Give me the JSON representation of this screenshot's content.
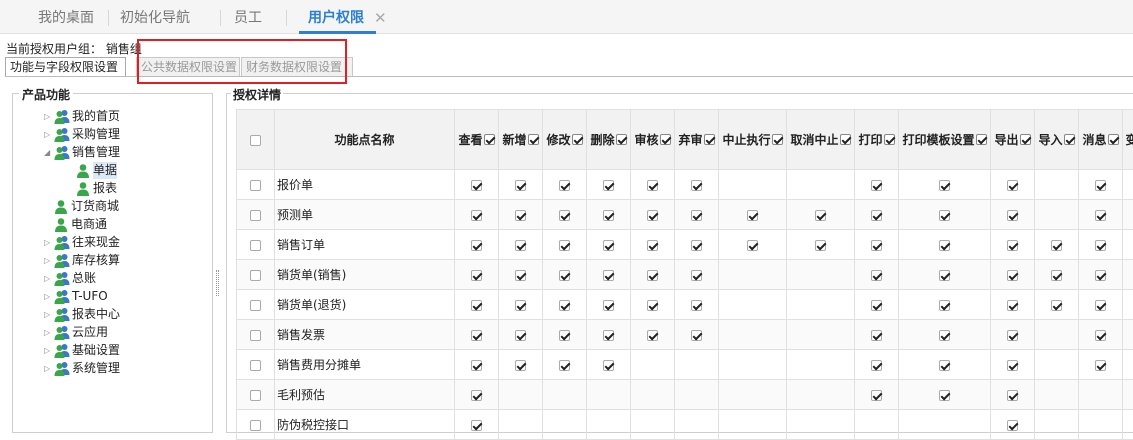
{
  "top_tabs": [
    {
      "label": "我的桌面",
      "active": false
    },
    {
      "label": "初始化导航",
      "active": false
    },
    {
      "label": "员工",
      "active": false
    },
    {
      "label": "用户权限",
      "active": true,
      "closable": true
    }
  ],
  "close_glyph": "✕",
  "role_line": "当前授权用户组： 销售组",
  "sub_tabs": [
    {
      "label": "功能与字段权限设置",
      "active": true
    },
    {
      "label": "公共数据权限设置",
      "active": false
    },
    {
      "label": "财务数据权限设置",
      "active": false
    }
  ],
  "left_panel": {
    "title": "产品功能",
    "tree": [
      {
        "label": "我的首页",
        "level": 1,
        "arrow": "▷",
        "icon": "user-group-icon"
      },
      {
        "label": "采购管理",
        "level": 1,
        "arrow": "▷",
        "icon": "user-group-icon"
      },
      {
        "label": "销售管理",
        "level": 1,
        "arrow": "◢",
        "icon": "user-group-icon"
      },
      {
        "label": "单据",
        "level": 2,
        "arrow": "",
        "icon": "user-icon",
        "selected": true
      },
      {
        "label": "报表",
        "level": 2,
        "arrow": "",
        "icon": "user-icon"
      },
      {
        "label": "订货商城",
        "level": 1,
        "arrow": "",
        "icon": "user-icon"
      },
      {
        "label": "电商通",
        "level": 1,
        "arrow": "",
        "icon": "user-icon"
      },
      {
        "label": "往来现金",
        "level": 1,
        "arrow": "▷",
        "icon": "user-group-icon"
      },
      {
        "label": "库存核算",
        "level": 1,
        "arrow": "▷",
        "icon": "user-group-icon"
      },
      {
        "label": "总账",
        "level": 1,
        "arrow": "▷",
        "icon": "user-group-icon"
      },
      {
        "label": "T-UFO",
        "level": 1,
        "arrow": "▷",
        "icon": "user-group-icon"
      },
      {
        "label": "报表中心",
        "level": 1,
        "arrow": "▷",
        "icon": "user-group-icon"
      },
      {
        "label": "云应用",
        "level": 1,
        "arrow": "▷",
        "icon": "user-group-icon"
      },
      {
        "label": "基础设置",
        "level": 1,
        "arrow": "▷",
        "icon": "user-group-icon"
      },
      {
        "label": "系统管理",
        "level": 1,
        "arrow": "▷",
        "icon": "user-group-icon"
      }
    ]
  },
  "right_panel": {
    "title": "授权详情",
    "name_header": "功能点名称",
    "columns": [
      "查看",
      "新增",
      "修改",
      "删除",
      "审核",
      "弃审",
      "中止执行",
      "取消中止",
      "打印",
      "打印模板设置",
      "导出",
      "导入",
      "消息",
      "变"
    ],
    "rows": [
      {
        "name": "报价单",
        "checked": [
          1,
          1,
          1,
          1,
          1,
          1,
          0,
          0,
          1,
          1,
          1,
          0,
          1,
          0
        ]
      },
      {
        "name": "预测单",
        "checked": [
          1,
          1,
          1,
          1,
          1,
          1,
          1,
          1,
          1,
          1,
          1,
          0,
          1,
          0
        ]
      },
      {
        "name": "销售订单",
        "checked": [
          1,
          1,
          1,
          1,
          1,
          1,
          1,
          1,
          1,
          1,
          1,
          1,
          1,
          0
        ]
      },
      {
        "name": "销货单(销售)",
        "checked": [
          1,
          1,
          1,
          1,
          1,
          1,
          0,
          0,
          1,
          1,
          1,
          1,
          1,
          0
        ]
      },
      {
        "name": "销货单(退货)",
        "checked": [
          1,
          1,
          1,
          1,
          1,
          1,
          0,
          0,
          1,
          1,
          1,
          1,
          1,
          0
        ]
      },
      {
        "name": "销售发票",
        "checked": [
          1,
          1,
          1,
          1,
          1,
          1,
          0,
          0,
          1,
          1,
          1,
          0,
          1,
          0
        ]
      },
      {
        "name": "销售费用分摊单",
        "checked": [
          1,
          1,
          1,
          1,
          0,
          0,
          0,
          0,
          1,
          1,
          1,
          0,
          1,
          0
        ]
      },
      {
        "name": "毛利预估",
        "checked": [
          1,
          0,
          0,
          0,
          0,
          0,
          0,
          0,
          1,
          1,
          1,
          0,
          0,
          0
        ]
      },
      {
        "name": "防伪税控接口",
        "checked": [
          1,
          0,
          0,
          0,
          0,
          0,
          0,
          0,
          0,
          0,
          1,
          0,
          0,
          0
        ]
      }
    ]
  },
  "colors": {
    "accent": "#2d7fd3",
    "highlight_box": "#e02020",
    "icon_green": "#3aa64a",
    "icon_blue": "#3a78c8"
  }
}
